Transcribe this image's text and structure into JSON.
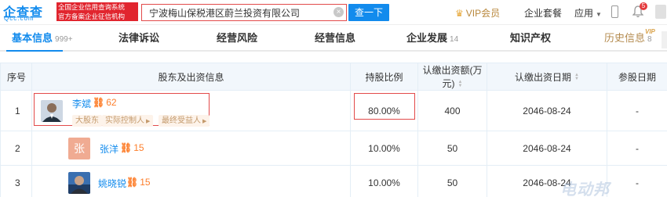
{
  "header": {
    "logo_mark": "企查查",
    "logo_domain": "Qcc.com",
    "slogan_line1": "全国企业信用查询系统",
    "slogan_line2": "官方备案企业征信机构",
    "search_value": "宁波梅山保税港区蔚兰投资有限公司",
    "search_clear": "×",
    "search_button": "查一下",
    "vip_label": "VIP会员",
    "package_label": "企业套餐",
    "app_label": "应用",
    "notification_count": "5"
  },
  "tabs": [
    {
      "label": "基本信息",
      "count": "999+"
    },
    {
      "label": "法律诉讼",
      "count": ""
    },
    {
      "label": "经营风险",
      "count": ""
    },
    {
      "label": "经营信息",
      "count": ""
    },
    {
      "label": "企业发展",
      "count": "14"
    },
    {
      "label": "知识产权",
      "count": ""
    },
    {
      "label": "历史信息",
      "count": "8"
    }
  ],
  "vip_tag": "VIP",
  "table": {
    "headers": {
      "index": "序号",
      "holder": "股东及出资信息",
      "ratio": "持股比例",
      "amount": "认缴出资额(万元)",
      "date": "认缴出资日期",
      "paid_date": "参股日期"
    },
    "rows": [
      {
        "index": "1",
        "name": "李斌",
        "link_count": "62",
        "tags": [
          "大股东",
          "实际控制人",
          "最终受益人"
        ],
        "ratio": "80.00%",
        "amount": "400",
        "date": "2046-08-24",
        "paid_date": "-"
      },
      {
        "index": "2",
        "avatar_letter": "张",
        "name": "张洋",
        "link_count": "15",
        "ratio": "10.00%",
        "amount": "50",
        "date": "2046-08-24",
        "paid_date": "-"
      },
      {
        "index": "3",
        "name": "姚晓锐",
        "link_count": "15",
        "ratio": "10.00%",
        "amount": "50",
        "date": "2046-08-24",
        "paid_date": "-"
      }
    ]
  },
  "watermark": "电动邦",
  "colors": {
    "brand_blue": "#128bed",
    "highlight_red": "#e24a4a",
    "link_orange": "#fd7e2b",
    "vip_gold": "#b8873b"
  },
  "icons": [
    "search-clear-icon",
    "crown-icon",
    "caret-down-icon",
    "phone-icon",
    "bell-icon",
    "link-icon",
    "sort-icon"
  ]
}
